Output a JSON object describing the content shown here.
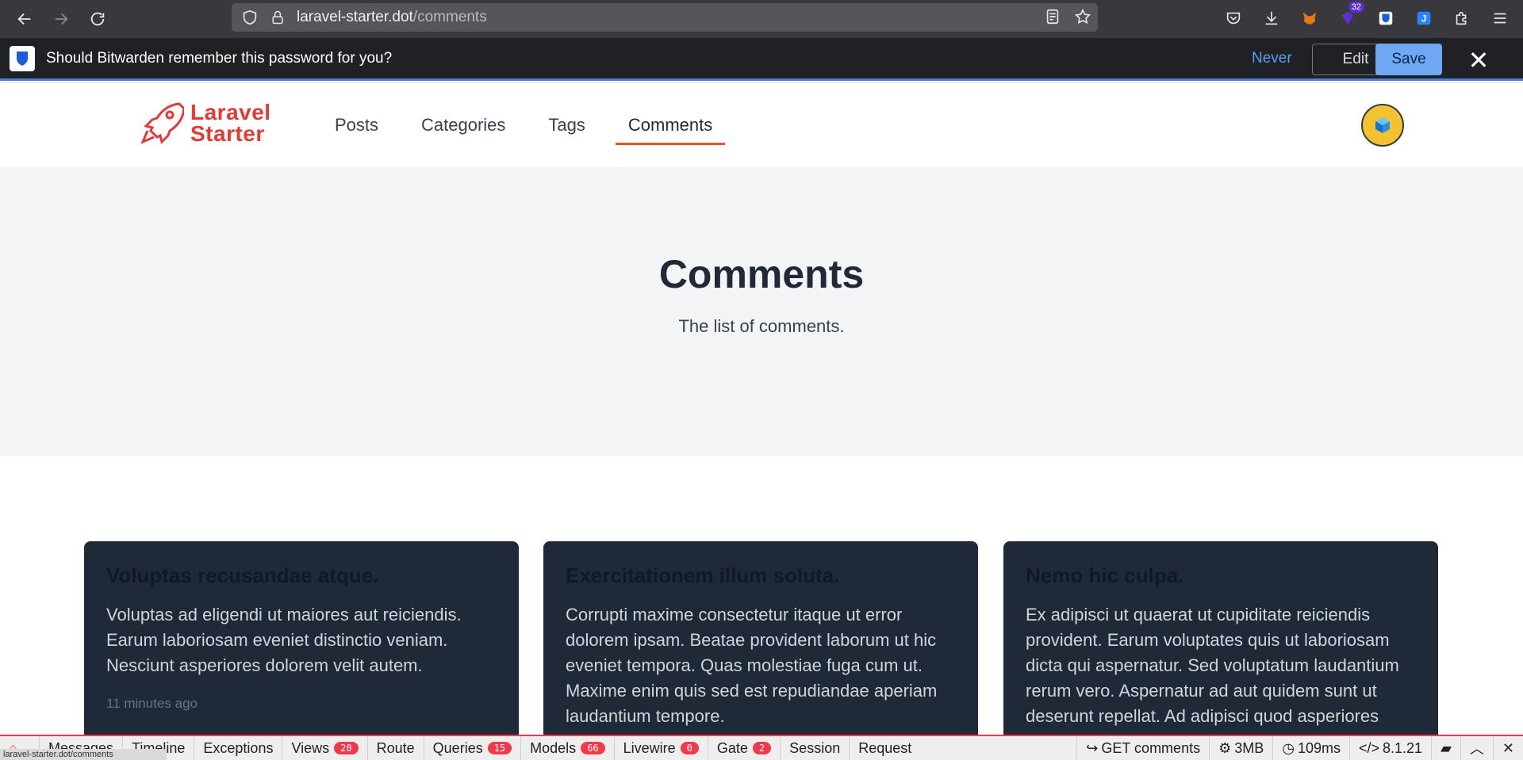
{
  "browser": {
    "url_host": "laravel-starter.dot",
    "url_path": "/comments",
    "extension_badge": "32"
  },
  "bitwarden": {
    "prompt": "Should Bitwarden remember this password for you?",
    "never_label": "Never",
    "edit_label": "Edit",
    "save_label": "Save"
  },
  "site": {
    "logo_line1": "Laravel",
    "logo_line2": "Starter",
    "nav": [
      {
        "label": "Posts"
      },
      {
        "label": "Categories"
      },
      {
        "label": "Tags"
      },
      {
        "label": "Comments",
        "active": true
      }
    ]
  },
  "hero": {
    "title": "Comments",
    "subtitle": "The list of comments."
  },
  "cards": [
    {
      "title": "Voluptas recusandae atque.",
      "body": "Voluptas ad eligendi ut maiores aut reiciendis. Earum laboriosam eveniet distinctio veniam. Nesciunt asperiores dolorem velit autem.",
      "time": "11 minutes ago"
    },
    {
      "title": "Exercitationem illum soluta.",
      "body": "Corrupti maxime consectetur itaque ut error dolorem ipsam. Beatae provident laborum ut hic eveniet tempora. Quas molestiae fuga cum ut. Maxime enim quis sed est repudiandae aperiam laudantium tempore.",
      "time": ""
    },
    {
      "title": "Nemo hic culpa.",
      "body": "Ex adipisci ut quaerat ut cupiditate reiciendis provident. Earum voluptates quis ut laboriosam dicta qui aspernatur. Sed voluptatum laudantium rerum vero. Aspernatur ad aut quidem sunt ut deserunt repellat. Ad adipisci quod asperiores",
      "time": ""
    }
  ],
  "debugbar": {
    "status_url": "laravel-starter.dot/comments",
    "tabs": [
      {
        "label": "Messages"
      },
      {
        "label": "Timeline"
      },
      {
        "label": "Exceptions"
      },
      {
        "label": "Views",
        "count": "20"
      },
      {
        "label": "Route"
      },
      {
        "label": "Queries",
        "count": "15"
      },
      {
        "label": "Models",
        "count": "66"
      },
      {
        "label": "Livewire",
        "count": "0"
      },
      {
        "label": "Gate",
        "count": "2"
      },
      {
        "label": "Session"
      },
      {
        "label": "Request"
      }
    ],
    "request": "GET comments",
    "memory": "3MB",
    "time": "109ms",
    "php": "8.1.21"
  }
}
